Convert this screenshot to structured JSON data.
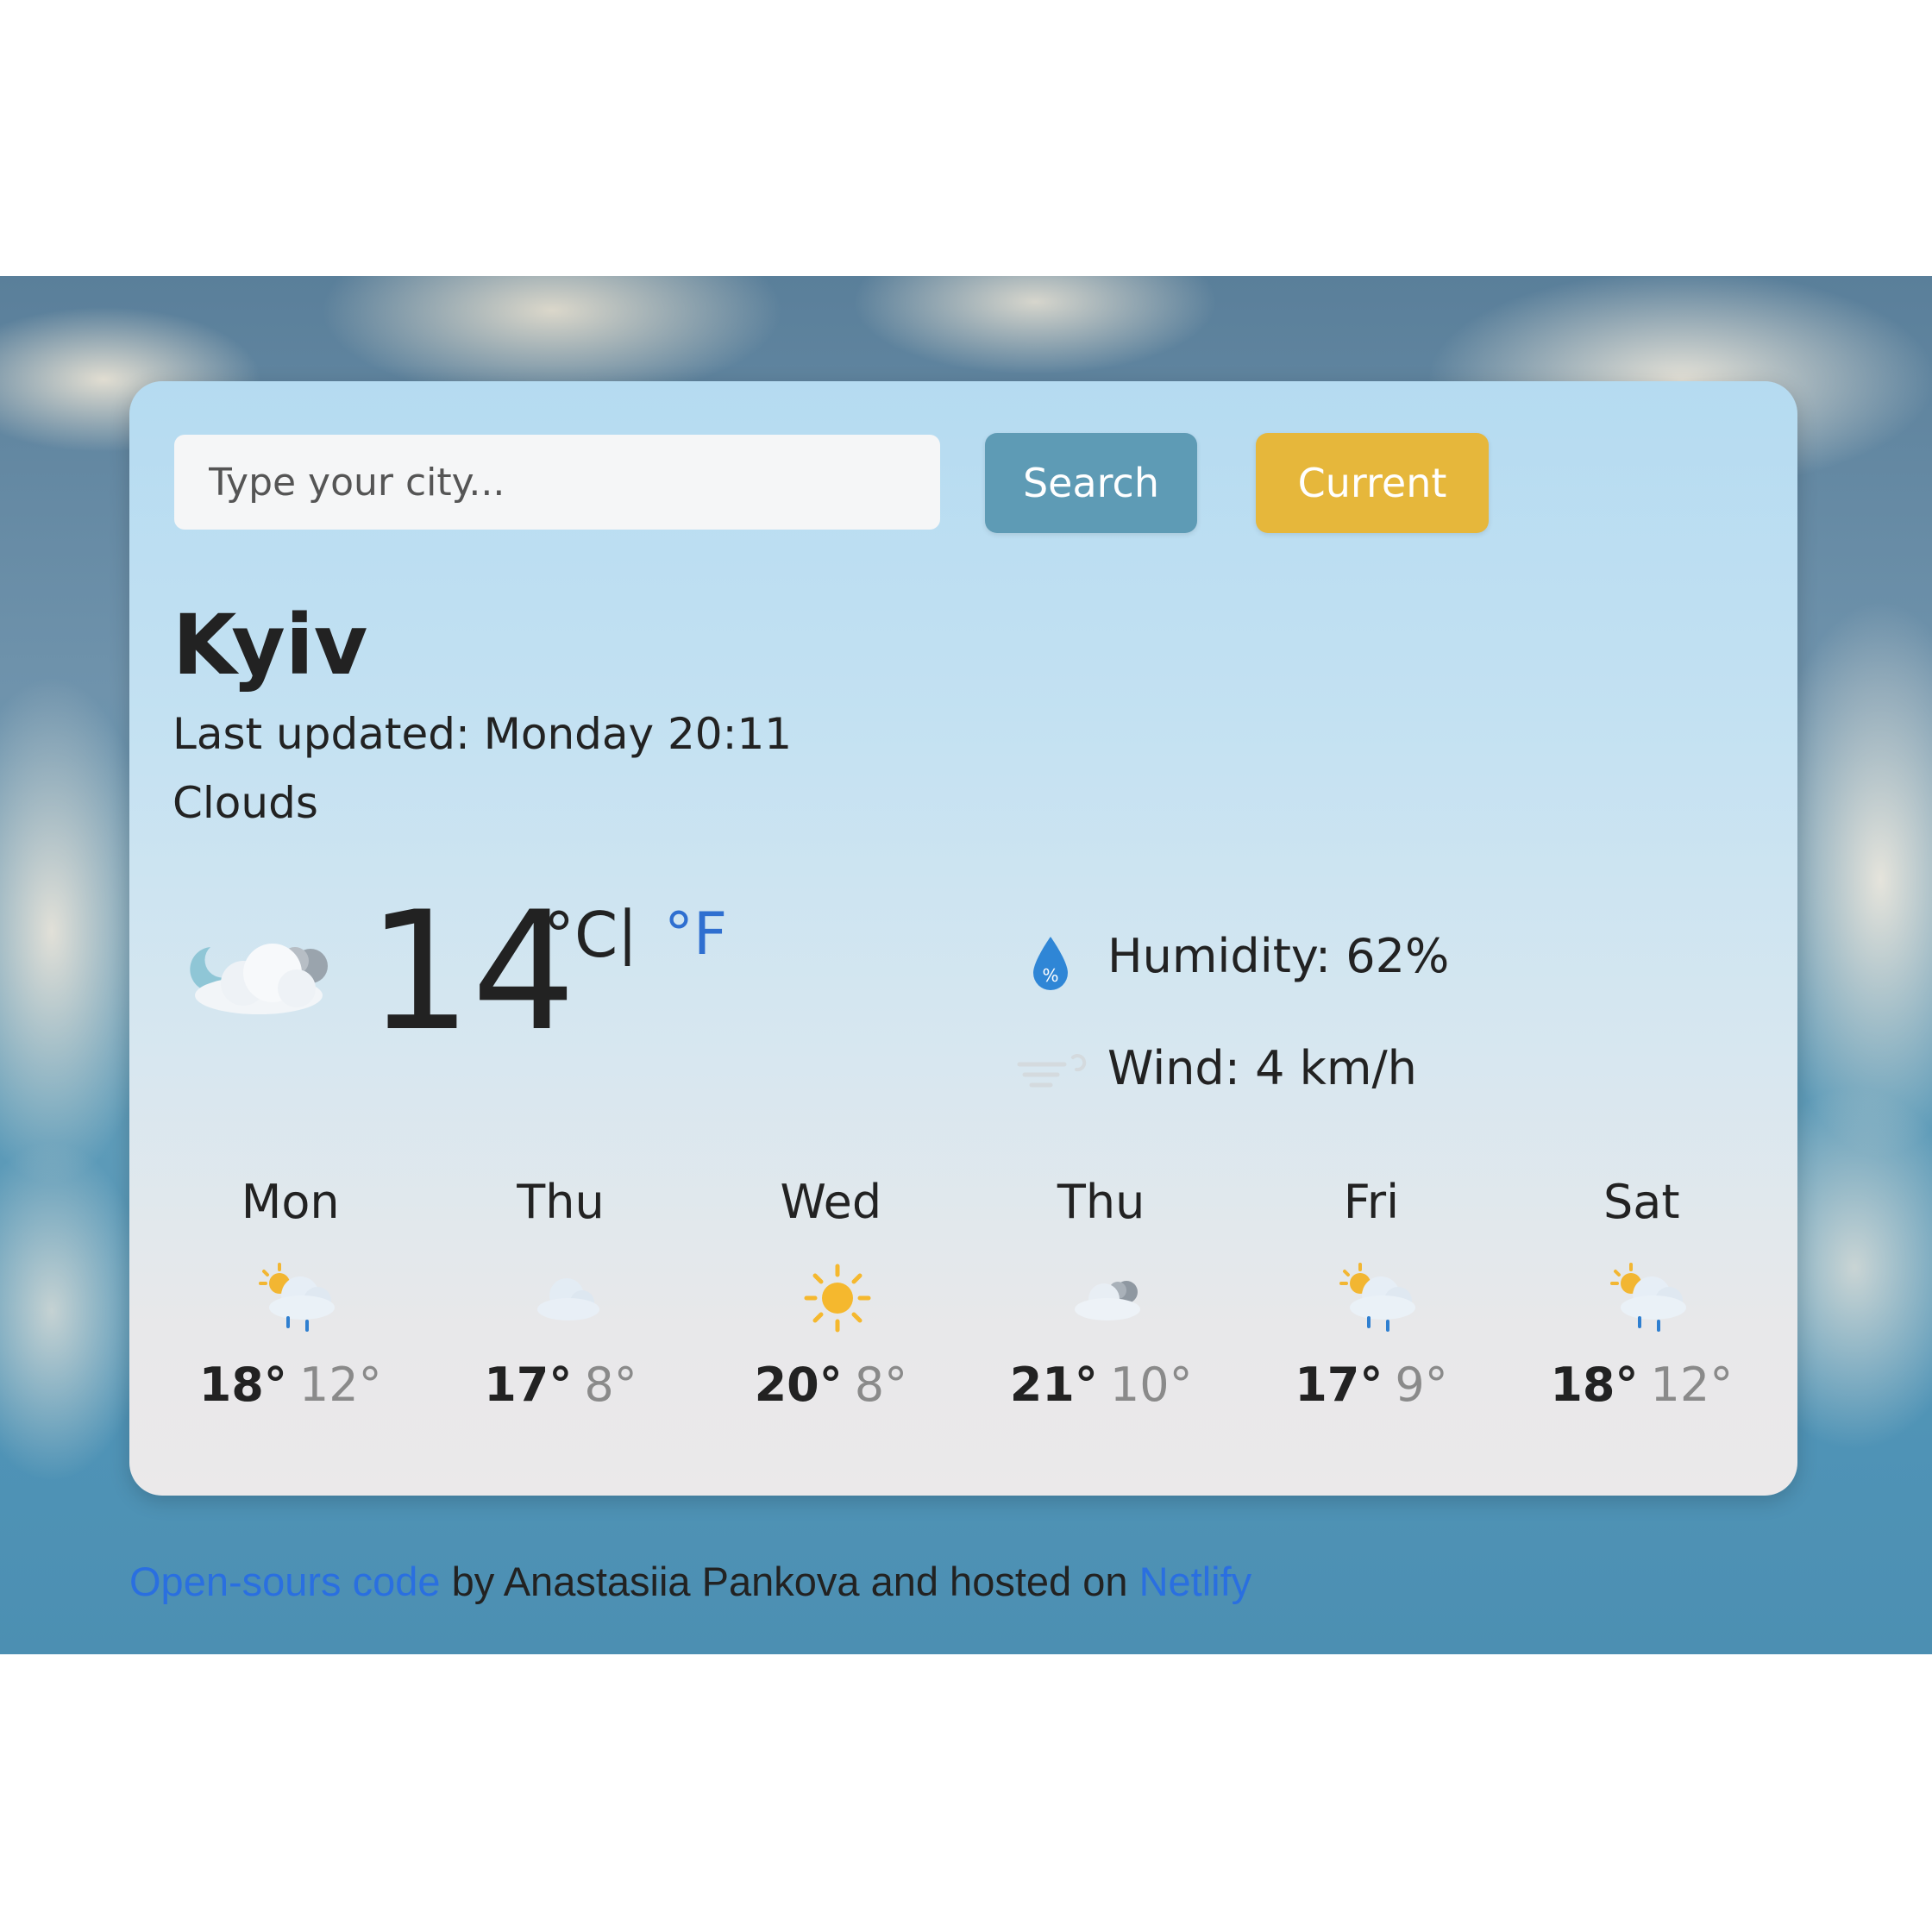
{
  "search": {
    "placeholder": "Type your city...",
    "search_label": "Search",
    "current_label": "Current"
  },
  "current": {
    "city": "Kyiv",
    "updated_label": "Last updated:",
    "updated_value": "Monday 20:11",
    "description": "Clouds",
    "icon": "few-clouds-night-icon",
    "temperature": "14",
    "unit_c": "°C",
    "unit_separator": "|",
    "unit_f": "°F",
    "humidity_label": "Humidity:",
    "humidity_value": "62%",
    "wind_label": "Wind:",
    "wind_value": "4 km/h"
  },
  "forecast": [
    {
      "day": "Mon",
      "icon": "sun-rain-icon",
      "max": "18°",
      "min": "12°"
    },
    {
      "day": "Thu",
      "icon": "cloud-icon",
      "max": "17°",
      "min": "8°"
    },
    {
      "day": "Wed",
      "icon": "sun-icon",
      "max": "20°",
      "min": "8°"
    },
    {
      "day": "Thu",
      "icon": "clouds-icon",
      "max": "21°",
      "min": "10°"
    },
    {
      "day": "Fri",
      "icon": "sun-rain-icon",
      "max": "17°",
      "min": "9°"
    },
    {
      "day": "Sat",
      "icon": "sun-rain-icon",
      "max": "18°",
      "min": "12°"
    }
  ],
  "footer": {
    "code_link": "Open-sours code",
    "middle_text": " by Anastasiia Pankova and hosted on ",
    "host_link": "Netlify"
  },
  "colors": {
    "search_button": "#5e9bb5",
    "current_button": "#e6b73b",
    "link": "#2a6fe0"
  }
}
